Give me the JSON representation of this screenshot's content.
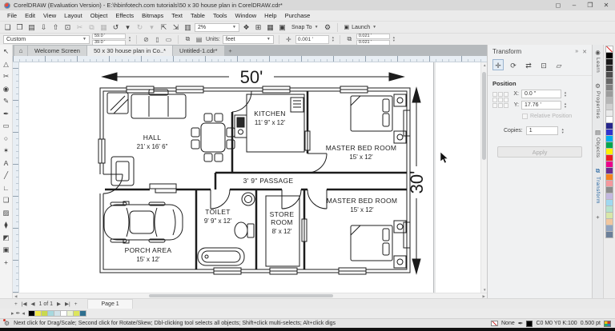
{
  "window": {
    "title": "CorelDRAW (Evaluation Version) - E:\\hbinfotech.com tutorials\\50 x 30 house plan in CorelDRAW.cdr*",
    "account_glyph": "◻",
    "minimize_glyph": "–",
    "restore_glyph": "❐",
    "close_glyph": "✕"
  },
  "menu": {
    "items": [
      "File",
      "Edit",
      "View",
      "Layout",
      "Object",
      "Effects",
      "Bitmaps",
      "Text",
      "Table",
      "Tools",
      "Window",
      "Help",
      "Purchase"
    ]
  },
  "toolbar": {
    "group1": [
      {
        "name": "new-document-icon",
        "glyph": "❏"
      },
      {
        "name": "open-icon",
        "glyph": "❒"
      },
      {
        "name": "save-icon",
        "glyph": "▤"
      },
      {
        "name": "import-icon",
        "glyph": "⇩"
      },
      {
        "name": "export-icon",
        "glyph": "⇧"
      },
      {
        "name": "print-icon",
        "glyph": "⊡"
      },
      {
        "name": "cut-icon",
        "glyph": "✂",
        "dim": true
      },
      {
        "name": "copy-icon",
        "glyph": "⧉",
        "dim": true
      },
      {
        "name": "paste-icon",
        "glyph": "▦",
        "dim": true
      },
      {
        "name": "undo-icon",
        "glyph": "↺"
      },
      {
        "name": "undo-dropdown-icon",
        "glyph": "▾"
      },
      {
        "name": "redo-icon",
        "glyph": "↻",
        "dim": true
      },
      {
        "name": "redo-dropdown-icon",
        "glyph": "▾",
        "dim": true
      },
      {
        "name": "zoom-to-page-icon",
        "glyph": "⇱"
      },
      {
        "name": "zoom-to-selection-icon",
        "glyph": "⇲"
      },
      {
        "name": "page-sorter-icon",
        "glyph": "▥"
      }
    ],
    "zoom_value": "2%",
    "group2": [
      {
        "name": "full-screen-preview-icon",
        "glyph": "❖"
      },
      {
        "name": "show-rulers-icon",
        "glyph": "⊞"
      },
      {
        "name": "show-grid-icon",
        "glyph": "▦"
      },
      {
        "name": "snap-off-icon",
        "glyph": "▣"
      }
    ],
    "snap_label": "Snap To",
    "options_glyph": "⚙",
    "launch_glyph": "▣",
    "launch_label": "Launch",
    "dropdown_glyph": "▾"
  },
  "property_bar": {
    "preset_value": "Custom",
    "page_width": "59.0 '",
    "page_height": "39.0 '",
    "delete_preset_glyph": "⊘",
    "portrait_glyph": "▯",
    "landscape_glyph": "▭",
    "all_pages_glyph": "⧉",
    "current_page_glyph": "▤",
    "units_label": "Units:",
    "units_value": "feet",
    "nudge_glyph": "✛",
    "nudge_value": "0.001 '",
    "dup_glyph": "⧉",
    "dup_x": "0.021 '",
    "dup_y": "0.021 '"
  },
  "tabs": {
    "home_glyph": "⌂",
    "items": [
      {
        "label": "Welcome Screen",
        "active": false
      },
      {
        "label": "50 x 30 house plan in Co..*",
        "active": true
      },
      {
        "label": "Untitled-1.cdr*",
        "active": false
      }
    ],
    "new_tab_glyph": "+"
  },
  "toolbox": [
    {
      "name": "pick-tool",
      "glyph": "↖"
    },
    {
      "name": "shape-tool",
      "glyph": "△"
    },
    {
      "name": "crop-tool",
      "glyph": "✂"
    },
    {
      "name": "zoom-tool",
      "glyph": "◉"
    },
    {
      "name": "freehand-tool",
      "glyph": "✎"
    },
    {
      "name": "artistic-media-tool",
      "glyph": "✒"
    },
    {
      "name": "rectangle-tool",
      "glyph": "▭"
    },
    {
      "name": "ellipse-tool",
      "glyph": "○"
    },
    {
      "name": "polygon-tool",
      "glyph": "✶"
    },
    {
      "name": "text-tool",
      "glyph": "A"
    },
    {
      "name": "dimension-tool",
      "glyph": "╱"
    },
    {
      "name": "connector-tool",
      "glyph": "∟"
    },
    {
      "name": "drop-shadow-tool",
      "glyph": "❑"
    },
    {
      "name": "transparency-tool",
      "glyph": "▨"
    },
    {
      "name": "eyedropper-tool",
      "glyph": "⧫"
    },
    {
      "name": "interactive-fill-tool",
      "glyph": "◩"
    },
    {
      "name": "smart-fill-tool",
      "glyph": "▣"
    },
    {
      "name": "more-tools",
      "glyph": "+"
    }
  ],
  "docker": {
    "title": "Transform",
    "collapse_glyph": "»",
    "close_glyph": "✕",
    "tools": [
      {
        "name": "transform-position-icon",
        "glyph": "✛",
        "active": true
      },
      {
        "name": "transform-rotate-icon",
        "glyph": "⟳"
      },
      {
        "name": "transform-scale-mirror-icon",
        "glyph": "⇄"
      },
      {
        "name": "transform-size-icon",
        "glyph": "⊡"
      },
      {
        "name": "transform-skew-icon",
        "glyph": "▱"
      }
    ],
    "position_label": "Position",
    "x_label": "X:",
    "x_value": "0.0 \"",
    "y_label": "Y:",
    "y_value": "17.76 '",
    "relative_label": "Relative Position",
    "copies_label": "Copies:",
    "copies_value": "1",
    "apply_label": "Apply"
  },
  "docker_tabs": [
    {
      "name": "learn",
      "glyph": "◉",
      "label": "Learn",
      "active": false
    },
    {
      "name": "properties",
      "glyph": "⚙",
      "label": "Properties",
      "active": false
    },
    {
      "name": "objects",
      "glyph": "▤",
      "label": "Objects",
      "active": false
    },
    {
      "name": "transform",
      "glyph": "⧉",
      "label": "Transform",
      "active": true
    },
    {
      "name": "add-docker",
      "glyph": "+",
      "label": "",
      "active": false
    }
  ],
  "palettes": {
    "main": [
      "none",
      "#000000",
      "#1a1a1a",
      "#343434",
      "#4e4e4e",
      "#686868",
      "#828282",
      "#9c9c9c",
      "#b6b6b6",
      "#d0d0d0",
      "#eaeaea",
      "#ffffff",
      "#26268c",
      "#3333cc",
      "#00adee",
      "#00a550",
      "#fef200",
      "#ee1c25",
      "#ec008b",
      "#6a2c90",
      "#f58220",
      "#f5989d",
      "#8c8c8c",
      "#c3b8e0",
      "#9fd8f0",
      "#b5e2cf",
      "#d7e7a9",
      "#f2c79f",
      "#90a4c0",
      "#6b7f99"
    ],
    "document": [
      "#000000",
      "#f2ea49",
      "#c9d94e",
      "#a6d8de",
      "#d2e3ea",
      "#ffffff",
      "#eaf2d0",
      "#dde65c",
      "#2f708f"
    ]
  },
  "page_nav": {
    "add_glyph": "+",
    "first_glyph": "|◀",
    "prev_glyph": "◀",
    "counter": "1 of 1",
    "next_glyph": "▶",
    "last_glyph": "▶|",
    "add2_glyph": "+",
    "page_tab": "Page 1"
  },
  "doc_palette": {
    "expand_glyph": "▸",
    "eyedropper_glyph": "✒",
    "collapse_glyph": "◂"
  },
  "status": {
    "hint": "Next click for Drag/Scale; Second click for Rotate/Skew; Dbl-clicking tool selects all objects; Shift+click multi-selects; Alt+click digs",
    "fill_label": "None",
    "outline_text": "C0 M0 Y0 K:100",
    "outline_width": "0.500 pt"
  },
  "plan": {
    "width_label": "50'",
    "height_label": "30'",
    "rooms": [
      {
        "name": "HALL",
        "size": "21' x 16' 6\""
      },
      {
        "name": "KITCHEN",
        "size": "11' 9\" x 12'"
      },
      {
        "name": "MASTER BED ROOM",
        "size": "15' x 12'"
      },
      {
        "name": "3' 9\" PASSAGE",
        "size": ""
      },
      {
        "name": "TOILET",
        "size": "9' 9\" x 12'"
      },
      {
        "name": "STORE ROOM",
        "name_lines": [
          "STORE",
          "ROOM"
        ],
        "size": "8' x 12'"
      },
      {
        "name": "MASTER BED ROOM",
        "size": "15' x 12'"
      },
      {
        "name": "PORCH AREA",
        "size": "15' x 12'"
      }
    ]
  }
}
